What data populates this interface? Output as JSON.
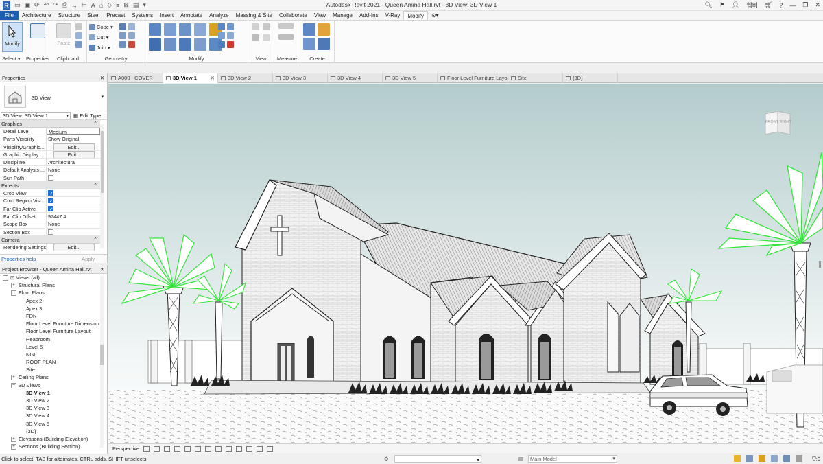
{
  "window": {
    "title": "Autodesk Revit 2021 - Queen Amina Hall.rvt - 3D View: 3D View 1",
    "app_letter": "R",
    "user_label": "웹비"
  },
  "tabs": [
    "File",
    "Architecture",
    "Structure",
    "Steel",
    "Precast",
    "Systems",
    "Insert",
    "Annotate",
    "Analyze",
    "Massing & Site",
    "Collaborate",
    "View",
    "Manage",
    "Add-Ins",
    "V-Ray",
    "Modify",
    "⊙▾"
  ],
  "active_tab": "Modify",
  "ribbon": {
    "select_group": {
      "modify_label": "Modify",
      "select_label": "Select ▾",
      "properties_label": "Properties"
    },
    "clipboard": {
      "paste_label": "Paste",
      "group_label": "Clipboard"
    },
    "geometry": {
      "cope_label": "Cope ▾",
      "cut_label": "Cut ▾",
      "join_label": "Join ▾",
      "group_label": "Geometry"
    },
    "modify_group_label": "Modify",
    "view_group_label": "View",
    "measure_group_label": "Measure",
    "create_group_label": "Create"
  },
  "view_tabs": [
    {
      "label": "A000 - COVER",
      "active": false
    },
    {
      "label": "3D View 1",
      "active": true
    },
    {
      "label": "3D View 2",
      "active": false
    },
    {
      "label": "3D View 3",
      "active": false
    },
    {
      "label": "3D View 4",
      "active": false
    },
    {
      "label": "3D View 5",
      "active": false
    },
    {
      "label": "Floor Level Furniture Layout",
      "active": false
    },
    {
      "label": "Site",
      "active": false
    },
    {
      "label": "{3D}",
      "active": false
    }
  ],
  "properties": {
    "header": "Properties",
    "type_name": "3D View",
    "instance_selector": "3D View: 3D View 1",
    "edit_type_label": "Edit Type",
    "sections": {
      "graphics": "Graphics",
      "extents": "Extents",
      "camera": "Camera"
    },
    "graphics_rows": [
      {
        "k": "Detail Level",
        "v": "Medium"
      },
      {
        "k": "Parts Visibility",
        "v": "Show Original"
      },
      {
        "k": "Visibility/Graphic...",
        "v": "Edit..."
      },
      {
        "k": "Graphic Display ...",
        "v": "Edit..."
      },
      {
        "k": "Discipline",
        "v": "Architectural"
      },
      {
        "k": "Default Analysis ...",
        "v": "None"
      },
      {
        "k": "Sun Path",
        "v": ""
      }
    ],
    "extents_rows": [
      {
        "k": "Crop View",
        "v": ""
      },
      {
        "k": "Crop Region Visi...",
        "v": ""
      },
      {
        "k": "Far Clip Active",
        "v": ""
      },
      {
        "k": "Far Clip Offset",
        "v": "97447.4"
      },
      {
        "k": "Scope Box",
        "v": "None"
      },
      {
        "k": "Section Box",
        "v": ""
      }
    ],
    "camera_rows": [
      {
        "k": "Rendering Settings",
        "v": "Edit..."
      }
    ],
    "help_label": "Properties help",
    "apply_label": "Apply"
  },
  "browser": {
    "header": "Project Browser - Queen Amina Hall.rvt",
    "items": [
      {
        "label": "Views (all)",
        "level": 0,
        "tw": "−"
      },
      {
        "label": "Structural Plans",
        "level": 1,
        "tw": "+"
      },
      {
        "label": "Floor Plans",
        "level": 1,
        "tw": "−"
      },
      {
        "label": "Apex 2",
        "level": 2,
        "tw": ""
      },
      {
        "label": "Apex 3",
        "level": 2,
        "tw": ""
      },
      {
        "label": "FDN",
        "level": 2,
        "tw": ""
      },
      {
        "label": "Floor Level Furniture Dimension",
        "level": 2,
        "tw": ""
      },
      {
        "label": "Floor Level Furniture Layout",
        "level": 2,
        "tw": ""
      },
      {
        "label": "Headroom",
        "level": 2,
        "tw": ""
      },
      {
        "label": "Level 5",
        "level": 2,
        "tw": ""
      },
      {
        "label": "NGL",
        "level": 2,
        "tw": ""
      },
      {
        "label": "ROOF PLAN",
        "level": 2,
        "tw": ""
      },
      {
        "label": "Site",
        "level": 2,
        "tw": ""
      },
      {
        "label": "Ceiling Plans",
        "level": 1,
        "tw": "+"
      },
      {
        "label": "3D Views",
        "level": 1,
        "tw": "−"
      },
      {
        "label": "3D View 1",
        "level": 2,
        "tw": "",
        "bold": true
      },
      {
        "label": "3D View 2",
        "level": 2,
        "tw": ""
      },
      {
        "label": "3D View 3",
        "level": 2,
        "tw": ""
      },
      {
        "label": "3D View 4",
        "level": 2,
        "tw": ""
      },
      {
        "label": "3D View 5",
        "level": 2,
        "tw": ""
      },
      {
        "label": "{3D}",
        "level": 2,
        "tw": ""
      },
      {
        "label": "Elevations (Building Elevation)",
        "level": 1,
        "tw": "+"
      },
      {
        "label": "Sections (Building Section)",
        "level": 1,
        "tw": "+"
      }
    ]
  },
  "viewcube": {
    "front": "FRONT",
    "right": "RIGHT"
  },
  "view_control": {
    "perspective_label": "Perspective"
  },
  "status": {
    "message": "Click to select, TAB for alternates, CTRL adds, SHIFT unselects.",
    "workset": "",
    "model": "Main Model",
    "filter": ":0"
  },
  "colors": {
    "file_tab": "#1c5fb0",
    "palm_green": "#33e53a",
    "sky_top": "#b4cccc",
    "sky_bottom": "#ffffff"
  }
}
